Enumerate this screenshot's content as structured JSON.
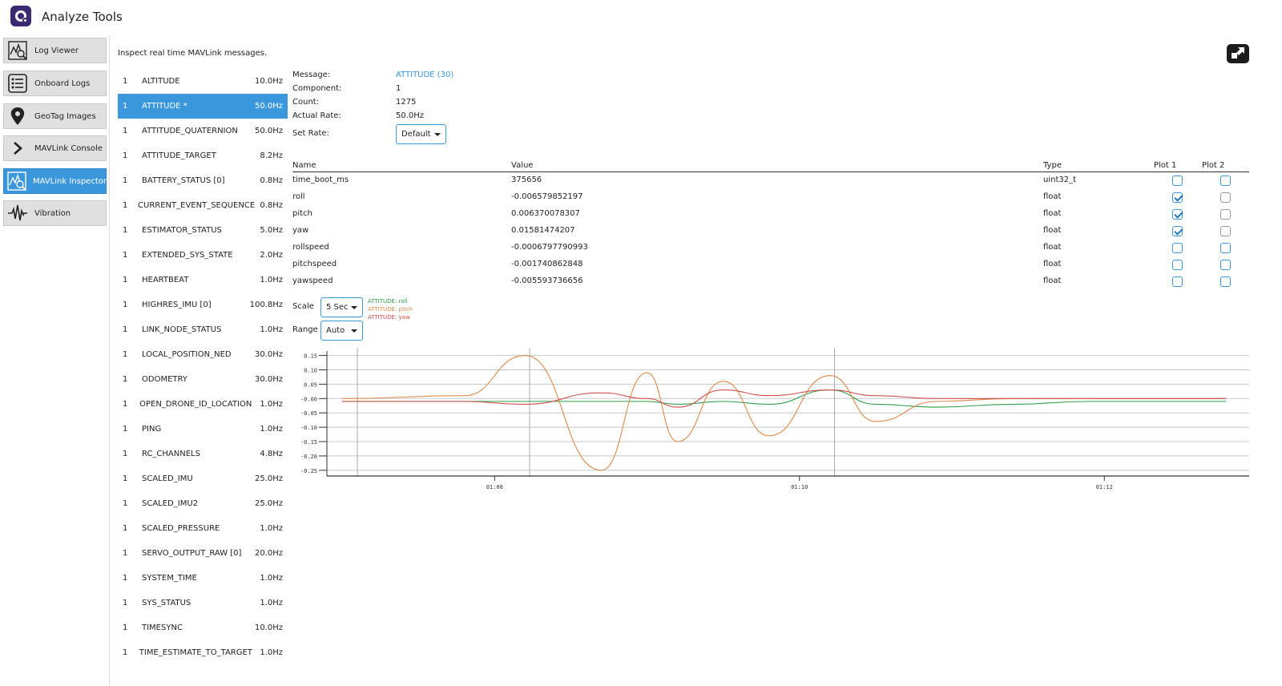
{
  "header": {
    "title": "Analyze Tools"
  },
  "sidebar": {
    "items": [
      {
        "label": "Log Viewer",
        "icon": "log-viewer-icon",
        "active": false
      },
      {
        "label": "Onboard Logs",
        "icon": "list-icon",
        "active": false
      },
      {
        "label": "GeoTag Images",
        "icon": "map-pin-icon",
        "active": false
      },
      {
        "label": "MAVLink Console",
        "icon": "chevron-right-icon",
        "active": false
      },
      {
        "label": "MAVLink Inspector",
        "icon": "inspector-icon",
        "active": true
      },
      {
        "label": "Vibration",
        "icon": "waveform-icon",
        "active": false
      }
    ]
  },
  "main": {
    "intro": "Inspect real time MAVLink messages.",
    "messages": [
      {
        "comp": "1",
        "name": "ALTITUDE",
        "rate": "10.0Hz"
      },
      {
        "comp": "1",
        "name": "ATTITUDE *",
        "rate": "50.0Hz",
        "selected": true
      },
      {
        "comp": "1",
        "name": "ATTITUDE_QUATERNION",
        "rate": "50.0Hz"
      },
      {
        "comp": "1",
        "name": "ATTITUDE_TARGET",
        "rate": "8.2Hz"
      },
      {
        "comp": "1",
        "name": "BATTERY_STATUS [0]",
        "rate": "0.8Hz"
      },
      {
        "comp": "1",
        "name": "CURRENT_EVENT_SEQUENCE",
        "rate": "0.8Hz"
      },
      {
        "comp": "1",
        "name": "ESTIMATOR_STATUS",
        "rate": "5.0Hz"
      },
      {
        "comp": "1",
        "name": "EXTENDED_SYS_STATE",
        "rate": "2.0Hz"
      },
      {
        "comp": "1",
        "name": "HEARTBEAT",
        "rate": "1.0Hz"
      },
      {
        "comp": "1",
        "name": "HIGHRES_IMU [0]",
        "rate": "100.8Hz"
      },
      {
        "comp": "1",
        "name": "LINK_NODE_STATUS",
        "rate": "1.0Hz"
      },
      {
        "comp": "1",
        "name": "LOCAL_POSITION_NED",
        "rate": "30.0Hz"
      },
      {
        "comp": "1",
        "name": "ODOMETRY",
        "rate": "30.0Hz"
      },
      {
        "comp": "1",
        "name": "OPEN_DRONE_ID_LOCATION",
        "rate": "1.0Hz"
      },
      {
        "comp": "1",
        "name": "PING",
        "rate": "1.0Hz"
      },
      {
        "comp": "1",
        "name": "RC_CHANNELS",
        "rate": "4.8Hz"
      },
      {
        "comp": "1",
        "name": "SCALED_IMU",
        "rate": "25.0Hz"
      },
      {
        "comp": "1",
        "name": "SCALED_IMU2",
        "rate": "25.0Hz"
      },
      {
        "comp": "1",
        "name": "SCALED_PRESSURE",
        "rate": "1.0Hz"
      },
      {
        "comp": "1",
        "name": "SERVO_OUTPUT_RAW [0]",
        "rate": "20.0Hz"
      },
      {
        "comp": "1",
        "name": "SYSTEM_TIME",
        "rate": "1.0Hz"
      },
      {
        "comp": "1",
        "name": "SYS_STATUS",
        "rate": "1.0Hz"
      },
      {
        "comp": "1",
        "name": "TIMESYNC",
        "rate": "10.0Hz"
      },
      {
        "comp": "1",
        "name": "TIME_ESTIMATE_TO_TARGET",
        "rate": "1.0Hz"
      }
    ],
    "details": {
      "message_label": "Message:",
      "message_value": "ATTITUDE (30)",
      "component_label": "Component:",
      "component_value": "1",
      "count_label": "Count:",
      "count_value": "1275",
      "rate_label": "Actual Rate:",
      "rate_value": "50.0Hz",
      "set_rate_label": "Set Rate:",
      "set_rate_value": "Default"
    },
    "fields": {
      "headers": {
        "name": "Name",
        "value": "Value",
        "type": "Type",
        "plot1": "Plot 1",
        "plot2": "Plot 2"
      },
      "rows": [
        {
          "name": "time_boot_ms",
          "value": "375656",
          "type": "uint32_t",
          "plot1": false,
          "plot2": false
        },
        {
          "name": "roll",
          "value": "-0.006579852197",
          "type": "float",
          "plot1": true,
          "plot2": false
        },
        {
          "name": "pitch",
          "value": "0.006370078307",
          "type": "float",
          "plot1": true,
          "plot2": false
        },
        {
          "name": "yaw",
          "value": "0.01581474207",
          "type": "float",
          "plot1": true,
          "plot2": false
        },
        {
          "name": "rollspeed",
          "value": "-0.0006797790993",
          "type": "float",
          "plot1": false,
          "plot2": false
        },
        {
          "name": "pitchspeed",
          "value": "-0.001740862848",
          "type": "float",
          "plot1": false,
          "plot2": false
        },
        {
          "name": "yawspeed",
          "value": "-0.005593736656",
          "type": "float",
          "plot1": false,
          "plot2": false
        }
      ]
    },
    "plot_controls": {
      "scale_label": "Scale",
      "scale_value": "5 Sec",
      "range_label": "Range",
      "range_value": "Auto"
    },
    "colors": {
      "accent": "#3b97dc",
      "roll": "#2e9e48",
      "pitch": "#e0894a",
      "yaw": "#d0504a"
    }
  },
  "chart_data": {
    "type": "line",
    "ylim": [
      -0.27,
      0.16
    ],
    "xlim": [
      66.9,
      72.95
    ],
    "yticks": [
      "0.15",
      "0.10",
      "0.05",
      "-0.00",
      "-0.05",
      "-0.10",
      "-0.15",
      "-0.20",
      "-0.25"
    ],
    "ytick_values": [
      0.15,
      0.1,
      0.05,
      0.0,
      -0.05,
      -0.1,
      -0.15,
      -0.2,
      -0.25
    ],
    "xticks": [
      "01:08",
      "01:10",
      "01:12"
    ],
    "xtick_values": [
      68,
      70,
      72
    ],
    "series": [
      {
        "name": "ATTITUDE: roll",
        "color": "#2e9e48",
        "x": [
          67.0,
          67.8,
          68.2,
          68.7,
          69.0,
          69.2,
          69.5,
          69.8,
          70.2,
          70.5,
          70.9,
          71.4,
          71.9,
          72.4,
          72.8
        ],
        "y": [
          -0.01,
          -0.01,
          -0.01,
          -0.01,
          -0.01,
          -0.02,
          -0.01,
          -0.02,
          0.03,
          -0.02,
          -0.03,
          -0.02,
          -0.01,
          -0.01,
          -0.01
        ]
      },
      {
        "name": "ATTITUDE: pitch",
        "color": "#e0894a",
        "x": [
          67.0,
          67.8,
          68.2,
          68.7,
          69.0,
          69.2,
          69.5,
          69.8,
          70.2,
          70.5,
          70.9,
          71.4,
          71.9,
          72.4,
          72.8
        ],
        "y": [
          0.0,
          0.01,
          0.15,
          -0.25,
          0.09,
          -0.15,
          0.06,
          -0.13,
          0.08,
          -0.08,
          -0.01,
          0.0,
          0.0,
          0.0,
          0.0
        ]
      },
      {
        "name": "ATTITUDE: yaw",
        "color": "#d0504a",
        "x": [
          67.0,
          67.8,
          68.2,
          68.7,
          69.0,
          69.2,
          69.5,
          69.8,
          70.2,
          70.5,
          70.9,
          71.4,
          71.9,
          72.4,
          72.8
        ],
        "y": [
          -0.01,
          -0.01,
          -0.02,
          0.02,
          0.0,
          -0.03,
          0.03,
          0.01,
          0.03,
          0.01,
          0.0,
          0.0,
          0.0,
          0.0,
          0.0
        ]
      }
    ]
  }
}
